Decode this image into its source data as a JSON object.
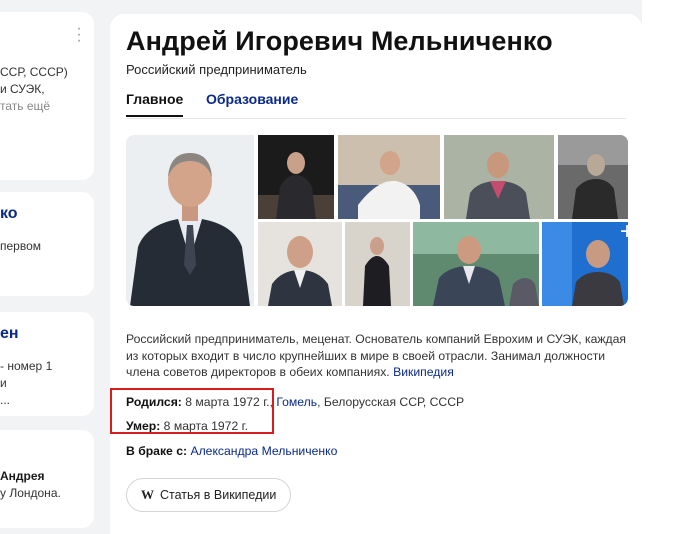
{
  "left_panel": {
    "cards": [
      {
        "lines": [
          "ССР, СССР)",
          "и СУЭК,",
          "тать ещё"
        ]
      },
      {
        "title": "ко",
        "lines": [
          "первом"
        ]
      },
      {
        "title": "ен",
        "lines": [
          "- номер 1",
          "и",
          "..."
        ]
      },
      {
        "bold": "Андрея",
        "lines": [
          "у Лондона."
        ]
      }
    ]
  },
  "entity": {
    "name": "Андрей Игоревич Мельниченко",
    "subtitle": "Российский предприниматель"
  },
  "tabs": [
    {
      "label": "Главное",
      "active": true
    },
    {
      "label": "Образование",
      "active": false
    }
  ],
  "gallery": {
    "more_icon": "plus-icon"
  },
  "description": {
    "text": "Российский предприниматель, меценат. Основатель компаний Еврохим и СУЭК, каждая из которых входит в число крупнейших в мире в своей отрасли. Занимал должности члена советов директоров в обеих компаниях.",
    "source": "Википедия"
  },
  "facts": {
    "born_label": "Родился:",
    "born_date": "8 марта 1972 г.,",
    "born_city": "Гомель",
    "born_rest": ", Белорусская ССР, СССР",
    "died_label": "Умер:",
    "died_date": "8 марта 1972 г.",
    "spouse_label": "В браке с:",
    "spouse_name": "Александра Мельниченко"
  },
  "wiki_button": {
    "icon": "W",
    "label": "Статья в Википедии"
  },
  "colors": {
    "link": "#0a2a8a",
    "highlight": "#d91c1c",
    "background": "#f2f3f5"
  }
}
